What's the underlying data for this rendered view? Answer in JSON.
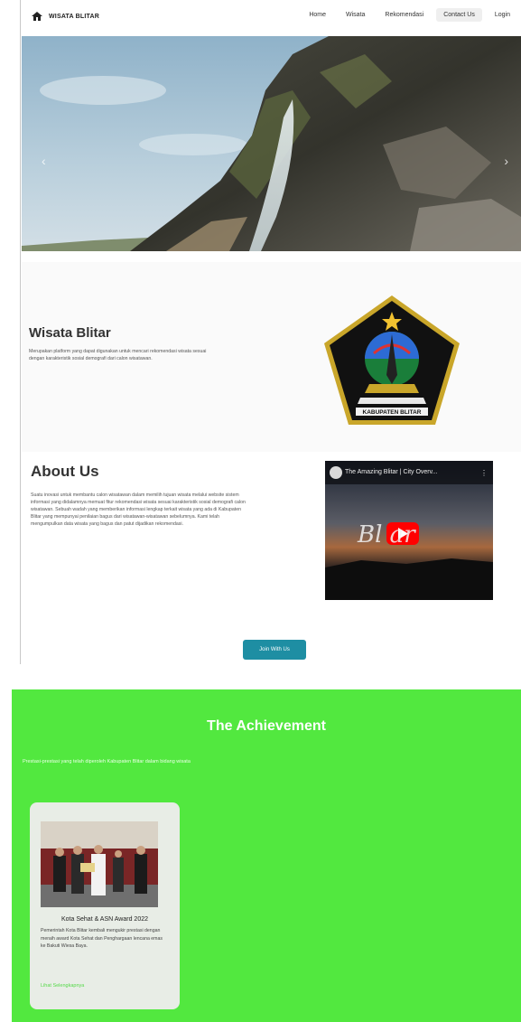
{
  "nav": {
    "brand": "WISATA BLITAR",
    "links": [
      "Home",
      "Wisata",
      "Rekomendasi",
      "Contact Us",
      "Login"
    ]
  },
  "hero": {
    "prev_icon": "chevron-left-icon",
    "next_icon": "chevron-right-icon"
  },
  "intro": {
    "title": "Wisata Blitar",
    "description": "Merupakan platform yang dapat digunakan untuk mencari rekomendasi wisata sesuai dengan karakteristik sosial demografi dari calon wisatawan.",
    "logo_caption": "KABUPATEN BLITAR"
  },
  "about": {
    "title": "About Us",
    "description": "Suatu inovasi untuk membantu calon wisatawan dalam memilih tujuan wisata melalui website sistem informasi yang didalamnya memuat fitur rekomendasi wisata sesuai karakteristik sosial demografi calon wisatawan. Sebuah wadah yang memberikan informasi lengkap terkait wisata yang ada di Kabupaten Blitar yang mempunyai penilaian bagus dari wisatawan-wisatawan sebelumnya. Kami telah mengumpulkan data wisata yang bagus dan patut dijadikan rekomendasi.",
    "video_title": "The Amazing Blitar | City Overv...",
    "video_overlay_text": "Bl   ar",
    "join_button": "Join With Us"
  },
  "achievement": {
    "title": "The Achievement",
    "subtitle": "Prestasi-prestasi yang telah diperoleh Kabupaten Blitar dalam bidang wisata",
    "cards": [
      {
        "title": "Kota Sehat & ASN Award 2022",
        "description": "Pemerintah Kota Blitar kembali mengukir prestasi dengan meraih award Kota Sehat dan Penghargaan lencana emas ke Bakuti Wiesa Baya.",
        "link": "Lihat Selengkapnya"
      }
    ]
  },
  "colors": {
    "achievement_bg": "#52e83f",
    "join_button": "#1e8ea3",
    "youtube_red": "#ff0000"
  }
}
